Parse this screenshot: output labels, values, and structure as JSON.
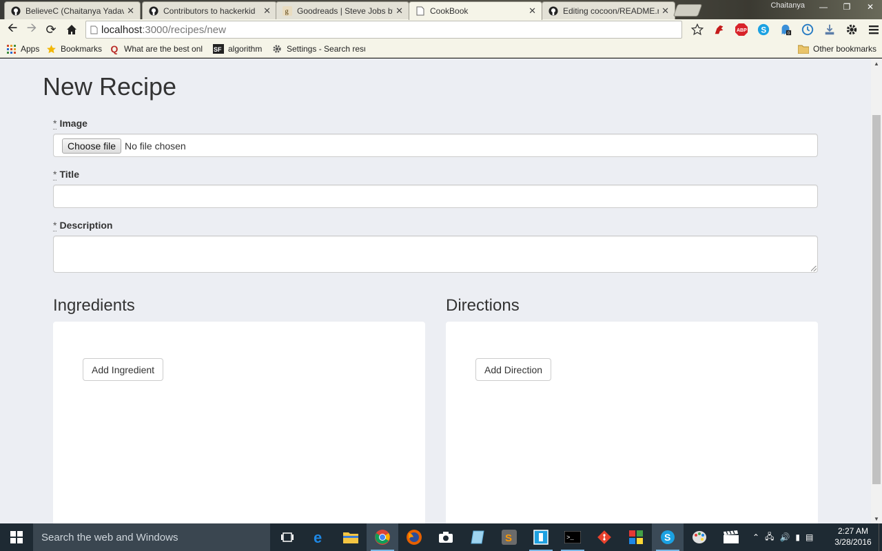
{
  "browser": {
    "tabs": [
      {
        "label": "BelieveC (Chaitanya Yadav",
        "icon": "github-icon",
        "active": false
      },
      {
        "label": "Contributors to hackerkid",
        "icon": "github-icon",
        "active": false
      },
      {
        "label": "Goodreads | Steve Jobs by",
        "icon": "goodreads-icon",
        "active": false
      },
      {
        "label": "CookBook",
        "icon": "page-icon",
        "active": true
      },
      {
        "label": "Editing cocoon/README.m",
        "icon": "github-icon",
        "active": false
      }
    ],
    "close_glyph": "✕",
    "profile_name": "Chaitanya",
    "url_host": "localhost",
    "url_path": ":3000/recipes/new",
    "bookmarks": [
      {
        "label": "Apps",
        "icon": "apps-grid-icon"
      },
      {
        "label": "Bookmarks",
        "icon": "star-icon"
      },
      {
        "label": "What are the best onl",
        "icon": "quora-icon"
      },
      {
        "label": "algorithm",
        "icon": "sf-icon"
      },
      {
        "label": "Settings - Search resu",
        "icon": "gear-icon"
      }
    ],
    "other_bookmarks": "Other bookmarks",
    "colors": {
      "chrome": "#f5f4e8",
      "page_bg": "#eceef3"
    }
  },
  "form": {
    "title": "New Recipe",
    "required_mark": "*",
    "image_label": "Image",
    "choose_file": "Choose file",
    "no_file": "No file chosen",
    "title_label": "Title",
    "title_value": "",
    "description_label": "Description",
    "description_value": "",
    "ingredients_heading": "Ingredients",
    "add_ingredient": "Add Ingredient",
    "directions_heading": "Directions",
    "add_direction": "Add Direction"
  },
  "taskbar": {
    "search_placeholder": "Search the web and Windows",
    "time": "2:27 AM",
    "date": "3/28/2016"
  }
}
